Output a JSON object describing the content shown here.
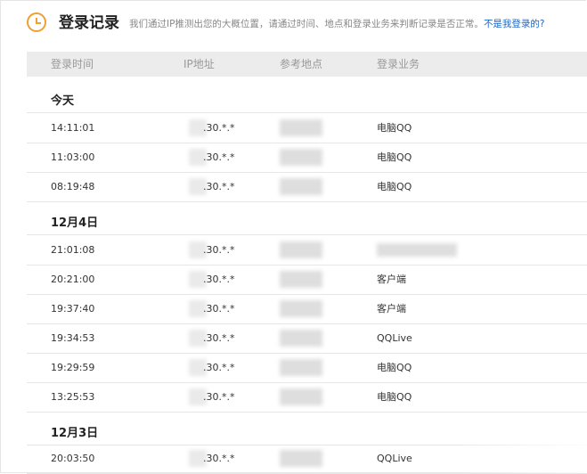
{
  "header": {
    "title": "登录记录",
    "description": "我们通过IP推测出您的大概位置，请通过时间、地点和登录业务来判断记录是否正常。",
    "link": "不是我登录的?"
  },
  "columns": [
    "登录时间",
    "IP地址",
    "参考地点",
    "登录业务"
  ],
  "groups": [
    {
      "label": "今天",
      "rows": [
        {
          "time": "14:11:01",
          "ip": ".30.*.*",
          "service": "电脑QQ"
        },
        {
          "time": "11:03:00",
          "ip": ".30.*.*",
          "service": "电脑QQ"
        },
        {
          "time": "08:19:48",
          "ip": ".30.*.*",
          "service": "电脑QQ"
        }
      ]
    },
    {
      "label": "12月4日",
      "rows": [
        {
          "time": "21:01:08",
          "ip": ".30.*.*",
          "service": ""
        },
        {
          "time": "20:21:00",
          "ip": ".30.*.*",
          "service": "客户端"
        },
        {
          "time": "19:37:40",
          "ip": ".30.*.*",
          "service": "客户端"
        },
        {
          "time": "19:34:53",
          "ip": ".30.*.*",
          "service": "QQLive"
        },
        {
          "time": "19:29:59",
          "ip": ".30.*.*",
          "service": "电脑QQ"
        },
        {
          "time": "13:25:53",
          "ip": ".30.*.*",
          "service": "电脑QQ"
        }
      ]
    },
    {
      "label": "12月3日",
      "rows": [
        {
          "time": "20:03:50",
          "ip": ".30.*.*",
          "service": "QQLive"
        }
      ]
    }
  ]
}
